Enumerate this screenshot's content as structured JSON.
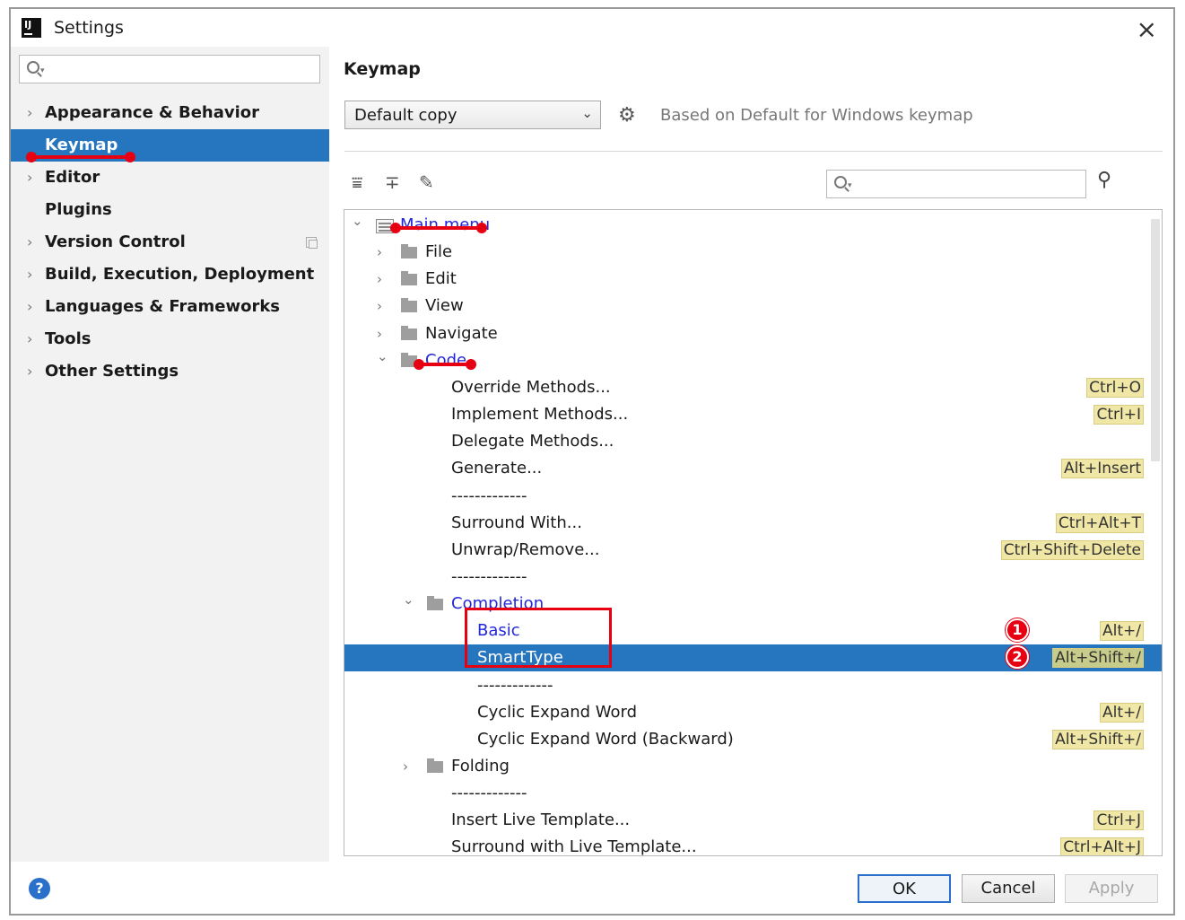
{
  "window": {
    "title": "Settings",
    "app_icon_text": "IJ"
  },
  "sidebar": {
    "search_placeholder": "",
    "items": [
      {
        "label": "Appearance & Behavior",
        "expandable": true,
        "selected": false
      },
      {
        "label": "Keymap",
        "expandable": false,
        "selected": true
      },
      {
        "label": "Editor",
        "expandable": true,
        "selected": false
      },
      {
        "label": "Plugins",
        "expandable": false,
        "selected": false
      },
      {
        "label": "Version Control",
        "expandable": true,
        "selected": false
      },
      {
        "label": "Build, Execution, Deployment",
        "expandable": true,
        "selected": false
      },
      {
        "label": "Languages & Frameworks",
        "expandable": true,
        "selected": false
      },
      {
        "label": "Tools",
        "expandable": true,
        "selected": false
      },
      {
        "label": "Other Settings",
        "expandable": true,
        "selected": false
      }
    ]
  },
  "main": {
    "title": "Keymap",
    "keymap_select": {
      "value": "Default copy"
    },
    "based_on": "Based on Default for Windows keymap",
    "tree_search_placeholder": ""
  },
  "tree": [
    {
      "label": "Main menu",
      "depth": 0,
      "kind": "menu",
      "expanded": true,
      "link": true
    },
    {
      "label": "File",
      "depth": 1,
      "kind": "folder",
      "expanded": false
    },
    {
      "label": "Edit",
      "depth": 1,
      "kind": "folder",
      "expanded": false
    },
    {
      "label": "View",
      "depth": 1,
      "kind": "folder",
      "expanded": false
    },
    {
      "label": "Navigate",
      "depth": 1,
      "kind": "folder",
      "expanded": false
    },
    {
      "label": "Code",
      "depth": 1,
      "kind": "folder",
      "expanded": true,
      "link": true
    },
    {
      "label": "Override Methods...",
      "depth": 2,
      "kind": "action",
      "shortcut": "Ctrl+O"
    },
    {
      "label": "Implement Methods...",
      "depth": 2,
      "kind": "action",
      "shortcut": "Ctrl+I"
    },
    {
      "label": "Delegate Methods...",
      "depth": 2,
      "kind": "action"
    },
    {
      "label": "Generate...",
      "depth": 2,
      "kind": "action",
      "shortcut": "Alt+Insert"
    },
    {
      "label": "-------------",
      "depth": 2,
      "kind": "separator"
    },
    {
      "label": "Surround With...",
      "depth": 2,
      "kind": "action",
      "shortcut": "Ctrl+Alt+T"
    },
    {
      "label": "Unwrap/Remove...",
      "depth": 2,
      "kind": "action",
      "shortcut": "Ctrl+Shift+Delete"
    },
    {
      "label": "-------------",
      "depth": 2,
      "kind": "separator"
    },
    {
      "label": "Completion",
      "depth": 2,
      "kind": "folder",
      "expanded": true,
      "link": true
    },
    {
      "label": "Basic",
      "depth": 3,
      "kind": "action",
      "shortcut": "Alt+/",
      "link": true,
      "badge": "1"
    },
    {
      "label": "SmartType",
      "depth": 3,
      "kind": "action",
      "shortcut": "Alt+Shift+/",
      "link": true,
      "selected": true,
      "badge": "2"
    },
    {
      "label": "-------------",
      "depth": 3,
      "kind": "separator"
    },
    {
      "label": "Cyclic Expand Word",
      "depth": 3,
      "kind": "action",
      "shortcut": "Alt+/"
    },
    {
      "label": "Cyclic Expand Word (Backward)",
      "depth": 3,
      "kind": "action",
      "shortcut": "Alt+Shift+/"
    },
    {
      "label": "Folding",
      "depth": 2,
      "kind": "folder",
      "expanded": false
    },
    {
      "label": "-------------",
      "depth": 2,
      "kind": "separator"
    },
    {
      "label": "Insert Live Template...",
      "depth": 2,
      "kind": "action",
      "shortcut": "Ctrl+J"
    },
    {
      "label": "Surround with Live Template...",
      "depth": 2,
      "kind": "action",
      "shortcut": "Ctrl+Alt+J"
    }
  ],
  "buttons": {
    "help": "?",
    "ok": "OK",
    "cancel": "Cancel",
    "apply": "Apply"
  },
  "colors": {
    "selection": "#2675bf",
    "link": "#2227d8",
    "annotation": "#e60012",
    "shortcut_bg": "#f0e7a6"
  },
  "icons": [
    "search-icon",
    "gear-icon",
    "expand-all-icon",
    "collapse-all-icon",
    "edit-icon",
    "find-shortcut-icon",
    "folder-icon",
    "menu-icon",
    "close-icon",
    "help-icon"
  ]
}
